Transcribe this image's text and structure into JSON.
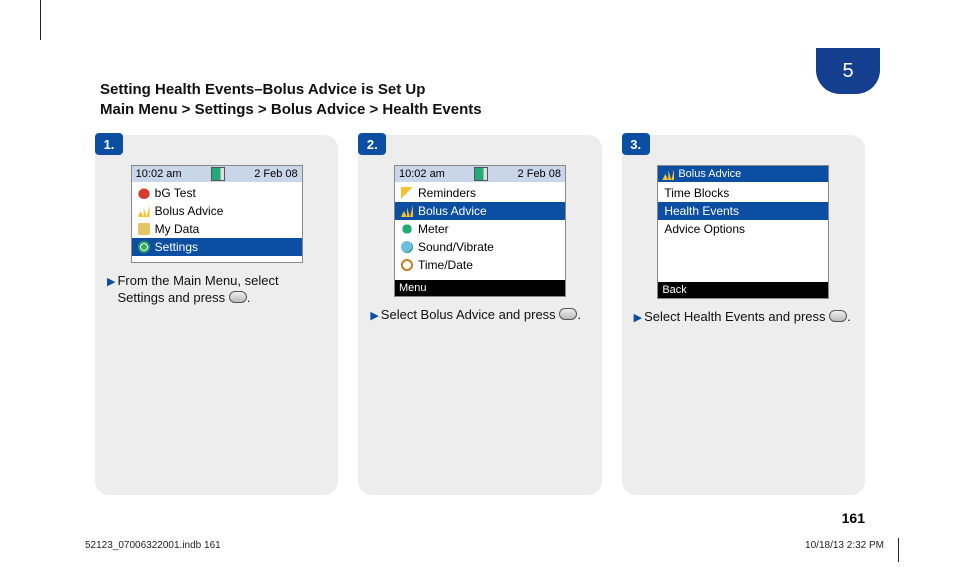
{
  "chapter": {
    "number": "5"
  },
  "title": {
    "line1": "Setting Health Events–Bolus Advice is Set Up",
    "line2": "Main Menu > Settings > Bolus Advice > Health Events"
  },
  "steps": [
    {
      "num": "1.",
      "phone": {
        "status_time": "10:02 am",
        "status_date": "2 Feb 08",
        "title": null,
        "items": [
          {
            "icon": "i-drop",
            "label": "bG Test",
            "selected": false
          },
          {
            "icon": "i-chart",
            "label": "Bolus Advice",
            "selected": false
          },
          {
            "icon": "i-folder",
            "label": "My Data",
            "selected": false
          },
          {
            "icon": "i-gear",
            "label": "Settings",
            "selected": true
          }
        ],
        "softkey": null
      },
      "caption": "From the Main Menu, select Settings and press"
    },
    {
      "num": "2.",
      "phone": {
        "status_time": "10:02 am",
        "status_date": "2 Feb 08",
        "title": null,
        "items": [
          {
            "icon": "i-flag",
            "label": "Reminders",
            "selected": false
          },
          {
            "icon": "i-chart",
            "label": "Bolus Advice",
            "selected": true
          },
          {
            "icon": "i-meter",
            "label": "Meter",
            "selected": false
          },
          {
            "icon": "i-globe",
            "label": "Sound/Vibrate",
            "selected": false
          },
          {
            "icon": "i-clock",
            "label": "Time/Date",
            "selected": false
          }
        ],
        "softkey": "Menu"
      },
      "caption": "Select Bolus Advice and press"
    },
    {
      "num": "3.",
      "phone": {
        "status_time": null,
        "status_date": null,
        "title": "Bolus Advice",
        "items": [
          {
            "icon": "i-blank",
            "label": "Time Blocks",
            "selected": false
          },
          {
            "icon": "i-blank",
            "label": "Health Events",
            "selected": true
          },
          {
            "icon": "i-blank",
            "label": "Advice Options",
            "selected": false
          }
        ],
        "softkey": "Back"
      },
      "caption": "Select Health Events and press"
    }
  ],
  "page_number": "161",
  "footer": {
    "left": "52123_07006322001.indb   161",
    "right": "10/18/13   2:32 PM"
  }
}
